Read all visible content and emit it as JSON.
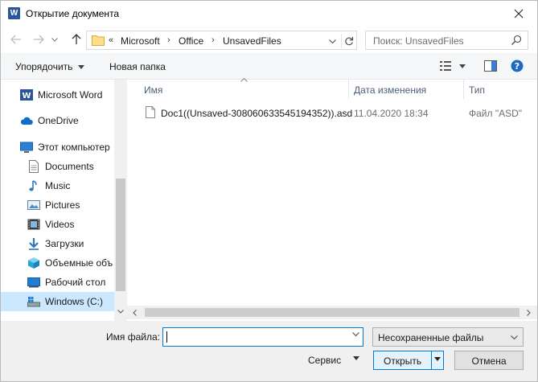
{
  "window": {
    "title": "Открытие документа",
    "app_icon_letter": "W",
    "accent_color": "#0078d7",
    "word_color": "#2b579a"
  },
  "address_bar": {
    "overflow": "«",
    "crumbs": [
      "Microsoft",
      "Office",
      "UnsavedFiles"
    ]
  },
  "search": {
    "placeholder": "Поиск: UnsavedFiles"
  },
  "toolbar": {
    "organize_label": "Упорядочить",
    "new_folder_label": "Новая папка"
  },
  "sidebar": {
    "items": [
      {
        "label": "Microsoft Word",
        "icon": "word-icon"
      },
      {
        "label": "OneDrive",
        "icon": "cloud-icon"
      },
      {
        "label": "Этот компьютер",
        "icon": "computer-icon"
      },
      {
        "label": "Documents",
        "icon": "documents-icon"
      },
      {
        "label": "Music",
        "icon": "music-icon"
      },
      {
        "label": "Pictures",
        "icon": "pictures-icon"
      },
      {
        "label": "Videos",
        "icon": "videos-icon"
      },
      {
        "label": "Загрузки",
        "icon": "download-icon"
      },
      {
        "label": "Объемные объ",
        "icon": "3d-objects-icon"
      },
      {
        "label": "Рабочий стол",
        "icon": "desktop-icon"
      },
      {
        "label": "Windows (C:)",
        "icon": "drive-icon",
        "selected": true
      }
    ]
  },
  "file_list": {
    "columns": [
      "Имя",
      "Дата изменения",
      "Тип"
    ],
    "rows": [
      {
        "name": "Doc1((Unsaved-308060633545194352)).asd",
        "date": "11.04.2020 18:34",
        "type": "Файл \"ASD\""
      }
    ]
  },
  "footer": {
    "filename_label": "Имя файла:",
    "filename_value": "",
    "filetype_value": "Несохраненные файлы",
    "service_label": "Сервис",
    "open_label": "Открыть",
    "cancel_label": "Отмена"
  }
}
